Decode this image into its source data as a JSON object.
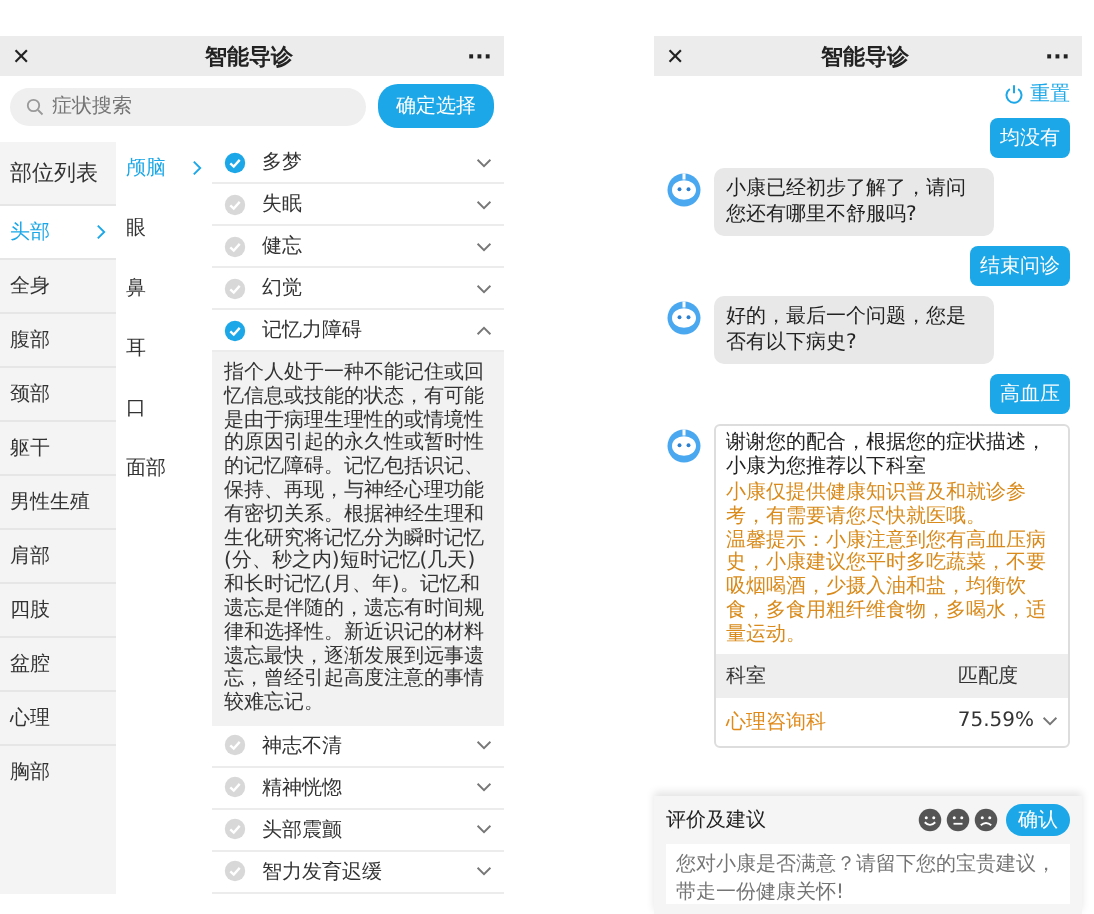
{
  "left_screen": {
    "title_bar": {
      "close": "✕",
      "title": "智能导诊",
      "more": "···"
    },
    "search": {
      "placeholder": "症状搜索",
      "button": "确定选择"
    },
    "parts_heading": "部位列表",
    "parts": [
      {
        "label": "头部",
        "selected": true
      },
      {
        "label": "全身",
        "selected": false
      },
      {
        "label": "腹部",
        "selected": false
      },
      {
        "label": "颈部",
        "selected": false
      },
      {
        "label": "躯干",
        "selected": false
      },
      {
        "label": "男性生殖",
        "selected": false
      },
      {
        "label": "肩部",
        "selected": false
      },
      {
        "label": "四肢",
        "selected": false
      },
      {
        "label": "盆腔",
        "selected": false
      },
      {
        "label": "心理",
        "selected": false
      },
      {
        "label": "胸部",
        "selected": false
      }
    ],
    "subparts": [
      {
        "label": "颅脑",
        "selected": true
      },
      {
        "label": "眼",
        "selected": false
      },
      {
        "label": "鼻",
        "selected": false
      },
      {
        "label": "耳",
        "selected": false
      },
      {
        "label": "口",
        "selected": false
      },
      {
        "label": "面部",
        "selected": false
      }
    ],
    "symptoms": [
      {
        "label": "多梦",
        "checked": true,
        "expanded": false
      },
      {
        "label": "失眠",
        "checked": false,
        "expanded": false
      },
      {
        "label": "健忘",
        "checked": false,
        "expanded": false
      },
      {
        "label": "幻觉",
        "checked": false,
        "expanded": false
      },
      {
        "label": "记忆力障碍",
        "checked": true,
        "expanded": true,
        "description": "指个人处于一种不能记住或回忆信息或技能的状态，有可能是由于病理生理性的或情境性的原因引起的永久性或暂时性的记忆障碍。记忆包括识记、保持、再现，与神经心理功能有密切关系。根据神经生理和生化研究将记忆分为瞬时记忆(分、秒之内)短时记忆(几天)和长时记忆(月、年)。记忆和遗忘是伴随的，遗忘有时间规律和选择性。新近识记的材料遗忘最快，逐渐发展到远事遗忘，曾经引起高度注意的事情较难忘记。"
      },
      {
        "label": "神志不清",
        "checked": false,
        "expanded": false
      },
      {
        "label": "精神恍惚",
        "checked": false,
        "expanded": false
      },
      {
        "label": "头部震颤",
        "checked": false,
        "expanded": false
      },
      {
        "label": "智力发育迟缓",
        "checked": false,
        "expanded": false
      }
    ]
  },
  "right_screen": {
    "title_bar": {
      "close": "✕",
      "title": "智能导诊",
      "more": "···"
    },
    "reset": "重置",
    "messages": [
      {
        "kind": "user",
        "text": "均没有"
      },
      {
        "kind": "bot",
        "text": "小康已经初步了解了，请问您还有哪里不舒服吗?"
      },
      {
        "kind": "user",
        "text": "结束问诊"
      },
      {
        "kind": "bot",
        "text": "好的，最后一个问题，您是否有以下病史?"
      },
      {
        "kind": "user",
        "text": "高血压"
      }
    ],
    "recommendation": {
      "intro": "谢谢您的配合，根据您的症状描述，小康为您推荐以下科室",
      "notes": [
        "小康仅提供健康知识普及和就诊参考，有需要请您尽快就医哦。",
        "温馨提示：小康注意到您有高血压病史，小康建议您平时多吃蔬菜，不要吸烟喝酒，少摄入油和盐，均衡饮食，多食用粗纤维食物，多喝水，适量运动。"
      ],
      "columns": [
        "科室",
        "匹配度"
      ],
      "rows": [
        {
          "department": "心理咨询科",
          "match": "75.59%"
        }
      ]
    },
    "feedback": {
      "label": "评价及建议",
      "ratings": [
        {
          "kind": "happy",
          "selected": false
        },
        {
          "kind": "neutral",
          "selected": false
        },
        {
          "kind": "sad",
          "selected": false
        }
      ],
      "confirm": "确认",
      "placeholder": "您对小康是否满意？请留下您的宝贵建议，带走一份健康关怀!"
    }
  }
}
